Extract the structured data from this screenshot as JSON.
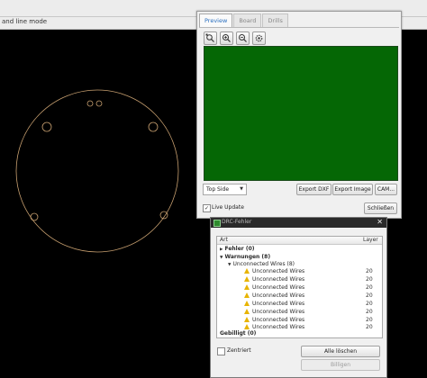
{
  "app": {
    "mode_text": "and line mode"
  },
  "preview": {
    "tabs": [
      {
        "label": "Preview",
        "active": true
      },
      {
        "label": "Board",
        "active": false
      },
      {
        "label": "Drills",
        "active": false
      }
    ],
    "tools": [
      {
        "icon": "zoom-selection-icon"
      },
      {
        "icon": "zoom-in-icon"
      },
      {
        "icon": "zoom-out-icon"
      },
      {
        "icon": "settings-gear-icon"
      }
    ],
    "board_color": "#056705",
    "side_select": {
      "value": "Top Side"
    },
    "buttons": {
      "export_dxf": "Export DXF",
      "export_image": "Export Image",
      "cam": "CAM...",
      "close": "Schließen"
    },
    "live_update": {
      "label": "Live Update",
      "checked": true
    }
  },
  "drc": {
    "title": "DRC-Fehler",
    "columns": {
      "art": "Art",
      "layer": "Layer"
    },
    "groups": [
      {
        "label": "Fehler (0)"
      },
      {
        "label": "Warnungen (8)"
      },
      {
        "label": "Unconnected Wires (8)"
      },
      {
        "label": "Gebilligt (0)"
      }
    ],
    "items": [
      {
        "label": "Unconnected Wires",
        "layer": "20"
      },
      {
        "label": "Unconnected Wires",
        "layer": "20"
      },
      {
        "label": "Unconnected Wires",
        "layer": "20"
      },
      {
        "label": "Unconnected Wires",
        "layer": "20"
      },
      {
        "label": "Unconnected Wires",
        "layer": "20"
      },
      {
        "label": "Unconnected Wires",
        "layer": "20"
      },
      {
        "label": "Unconnected Wires",
        "layer": "20"
      },
      {
        "label": "Unconnected Wires",
        "layer": "20"
      }
    ],
    "zentriert": {
      "label": "Zentriert",
      "checked": false
    },
    "buttons": {
      "clear_all": "Alle löschen",
      "approve": "Billigen"
    },
    "warning_color": "#e8b400"
  },
  "outline_color": "#c8a070"
}
